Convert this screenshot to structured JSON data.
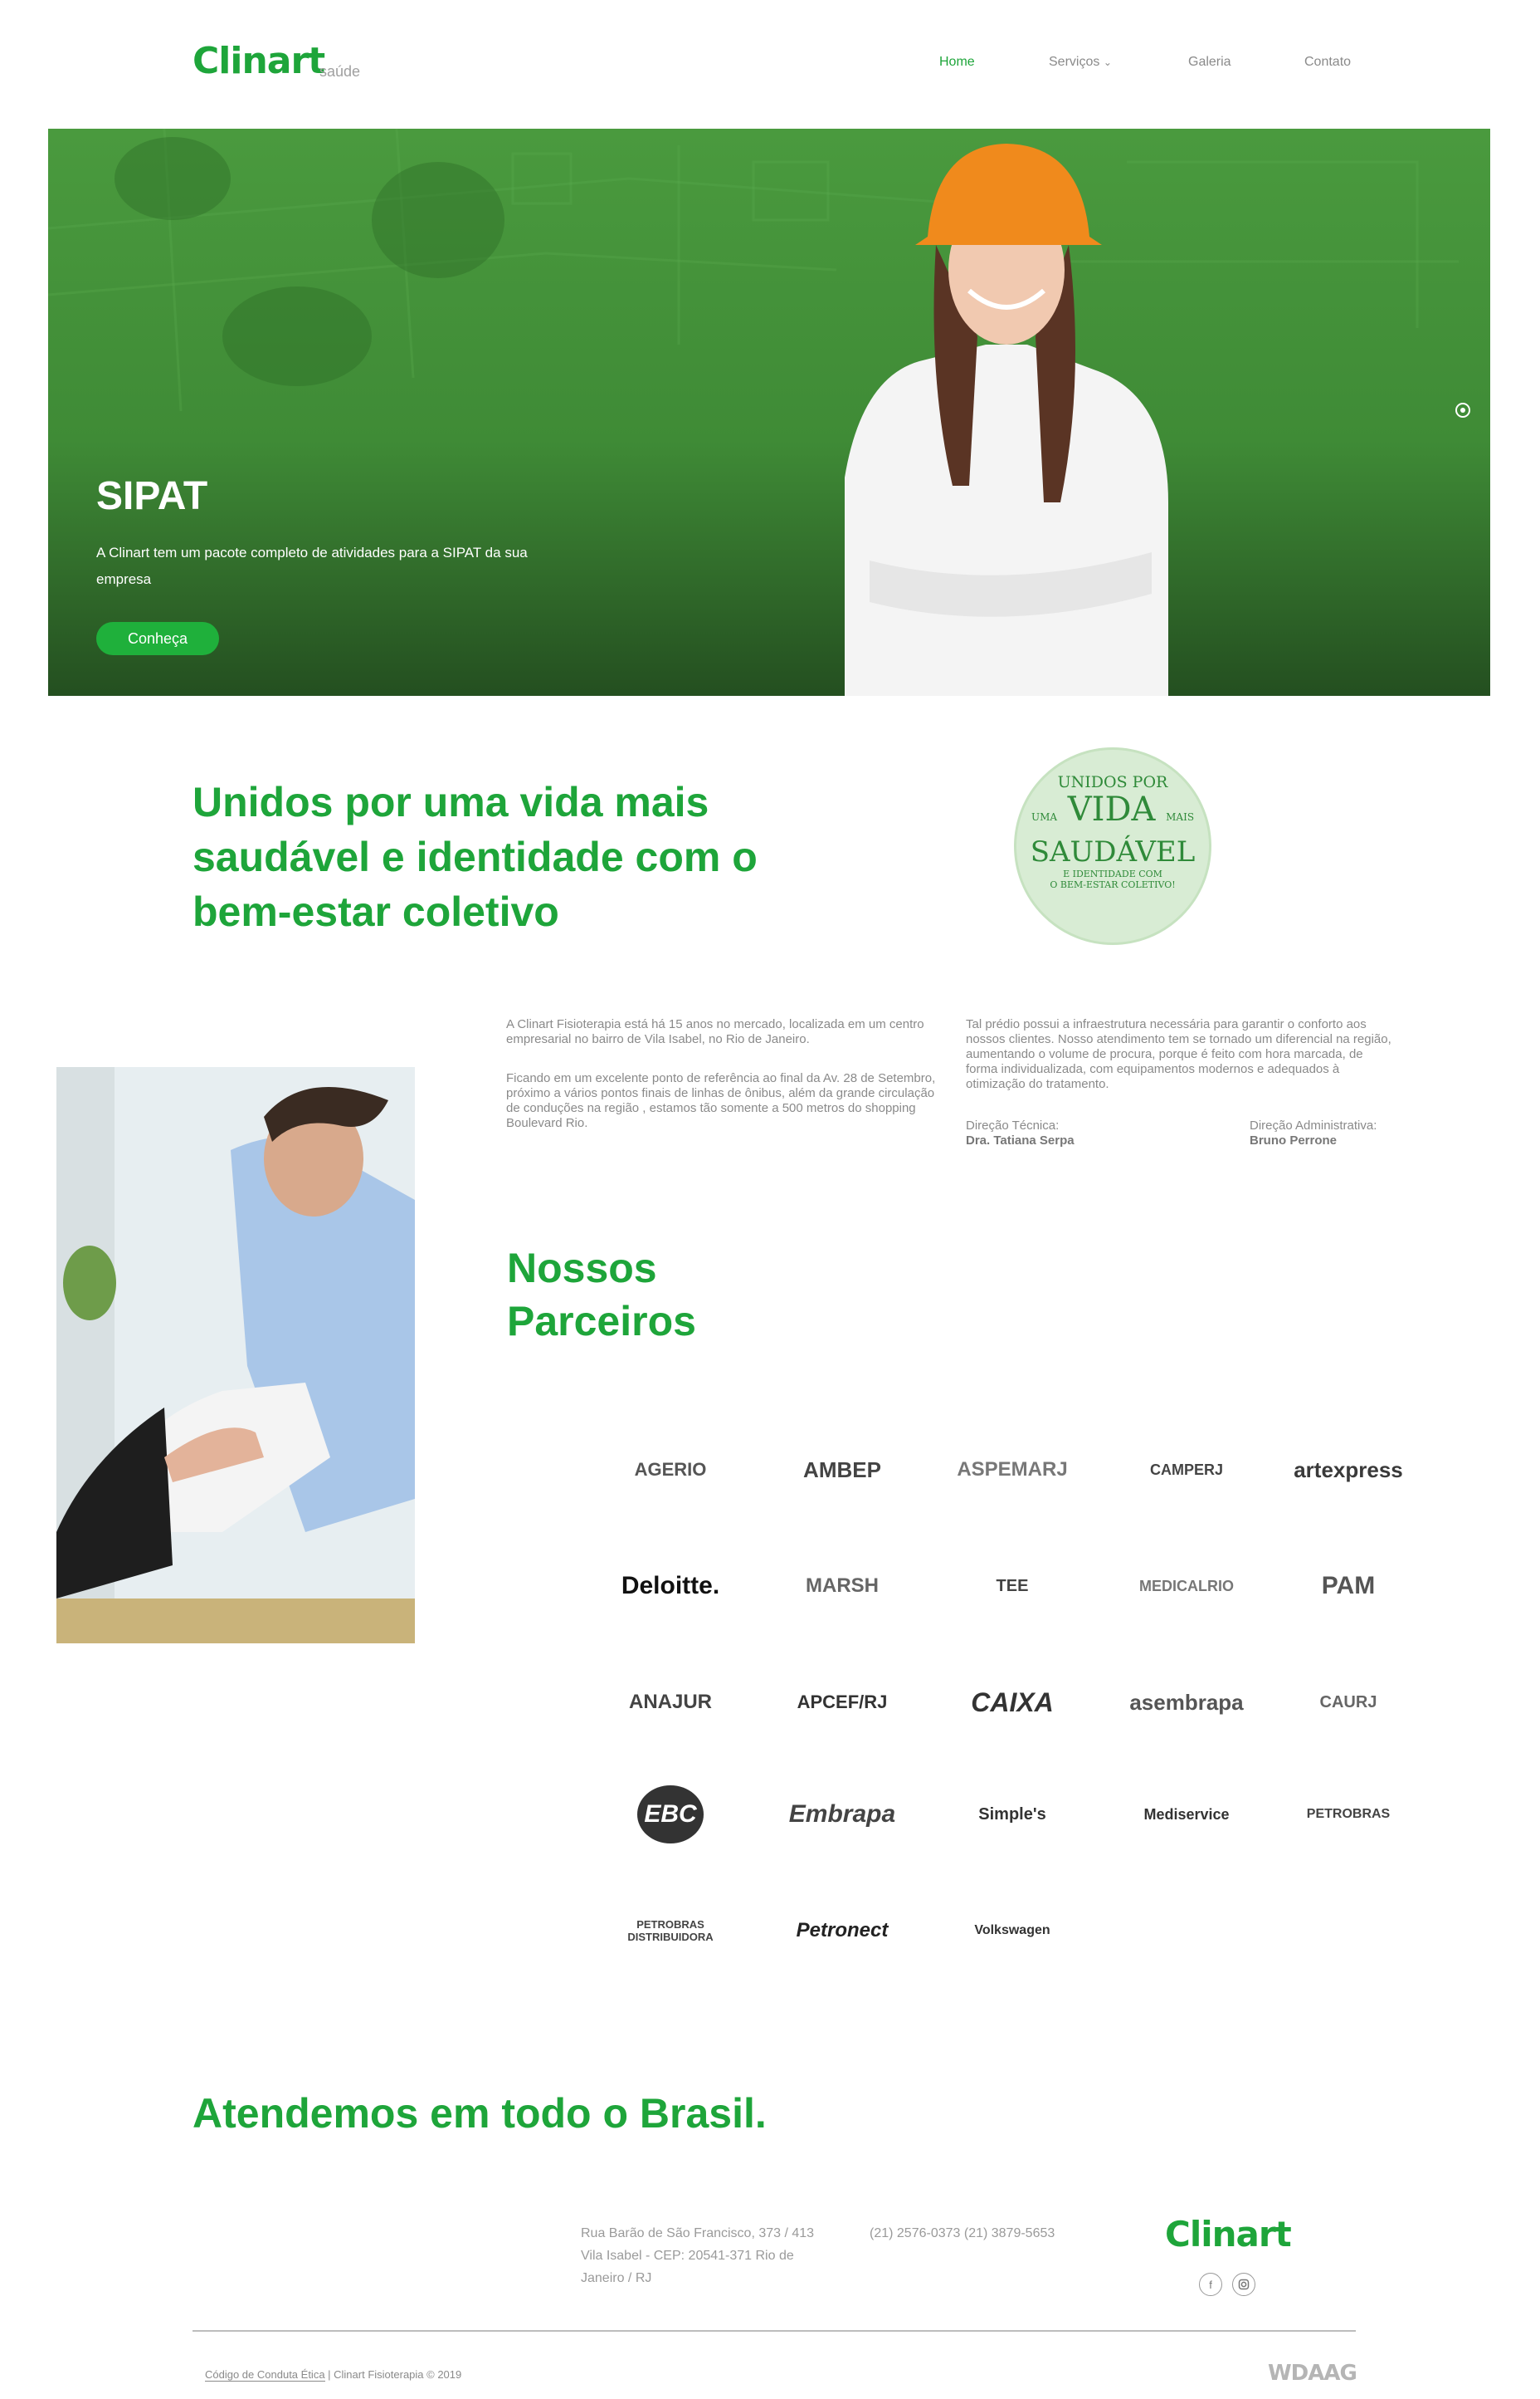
{
  "header": {
    "logo": "Clinart",
    "logo_sub": "saúde",
    "nav": [
      {
        "label": "Home"
      },
      {
        "label": "Serviços"
      },
      {
        "label": "Galeria"
      },
      {
        "label": "Contato"
      }
    ]
  },
  "hero": {
    "title": "SIPAT",
    "description": "A Clinart tem um pacote completo de atividades para a SIPAT da sua empresa",
    "button": "Conheça"
  },
  "intro": {
    "heading": "Unidos por uma vida mais saudável e identidade com o bem-estar coletivo",
    "badge": {
      "line1": "UNIDOS POR",
      "line2a": "UMA",
      "line2b": "VIDA",
      "line2c": "MAIS",
      "line3": "SAUDÁVEL",
      "line4": "E IDENTIDADE COM",
      "line5": "O BEM-ESTAR COLETIVO!"
    }
  },
  "about": {
    "col1_p1": "A Clinart Fisioterapia está há 15 anos no mercado, localizada em um centro empresarial no bairro de Vila Isabel, no Rio de Janeiro.",
    "col1_p2": "Ficando em um excelente ponto de referência ao final da Av. 28 de Setembro, próximo a vários pontos finais de linhas de ônibus, além da grande circulação de conduções na região , estamos tão somente a 500 metros do shopping Boulevard Rio.",
    "col2_p1": "Tal prédio possui a infraestrutura necessária para garantir o conforto aos nossos clientes. Nosso atendimento tem se tornado um diferencial na região, aumentando o volume de procura, porque é feito com hora marcada, de forma individualizada, com equipamentos modernos e adequados à otimização do tratamento.",
    "tech_label": "Direção Técnica:",
    "tech_name": "Dra. Tatiana Serpa",
    "admin_label": "Direção Administrativa:",
    "admin_name": "Bruno Perrone"
  },
  "partners": {
    "heading_line1": "Nossos",
    "heading_line2": "Parceiros",
    "logos": [
      {
        "name": "AGERIO"
      },
      {
        "name": "AMBEP"
      },
      {
        "name": "ASPEMARJ"
      },
      {
        "name": "CAMPERJ"
      },
      {
        "name": "artexpress"
      },
      {
        "name": "Deloitte."
      },
      {
        "name": "MARSH"
      },
      {
        "name": "TEE"
      },
      {
        "name": "MEDICALRIO"
      },
      {
        "name": "PAM"
      },
      {
        "name": "ANAJUR"
      },
      {
        "name": "APCEF/RJ"
      },
      {
        "name": "CAIXA"
      },
      {
        "name": "asembrapa"
      },
      {
        "name": "CAURJ"
      },
      {
        "name": "EBC"
      },
      {
        "name": "Embrapa"
      },
      {
        "name": "Simple's"
      },
      {
        "name": "Mediservice"
      },
      {
        "name": "PETROBRAS"
      },
      {
        "name": "PETROBRAS DISTRIBUIDORA"
      },
      {
        "name": "Petronect"
      },
      {
        "name": "Volkswagen"
      }
    ]
  },
  "coverage": {
    "heading": "Atendemos em todo o Brasil."
  },
  "footer": {
    "address_l1": "Rua Barão de São Francisco, 373 / 413",
    "address_l2": "Vila Isabel - CEP: 20541-371 Rio de",
    "address_l3": "Janeiro / RJ",
    "phones": "(21) 2576-0373 (21) 3879-5653",
    "logo": "Clinart",
    "copyright_link": "Código de Conduta Ética",
    "copyright_rest": " | Clinart Fisioterapia © 2019",
    "credit": "WDAAG"
  },
  "colors": {
    "brand_green": "#1ea53a",
    "hero_green": "#3f8b36"
  }
}
